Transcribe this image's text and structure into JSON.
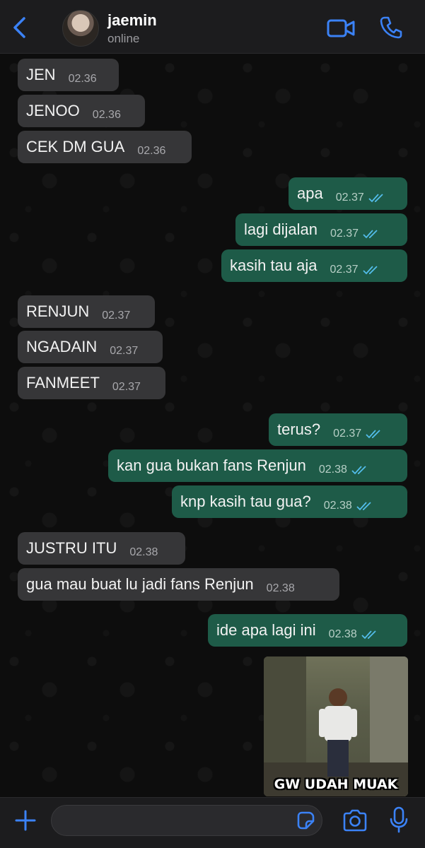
{
  "colors": {
    "accent": "#3b82f6",
    "incoming_bubble": "#363638",
    "outgoing_bubble": "#1e5b48",
    "read_ticks": "#53bdeb"
  },
  "header": {
    "contact_name": "jaemin",
    "status": "online",
    "icons": [
      "chevron-left-icon",
      "video-call-icon",
      "phone-icon"
    ]
  },
  "messages": [
    {
      "dir": "in",
      "text": "JEN",
      "time": "02.36"
    },
    {
      "dir": "in",
      "text": "JENOO",
      "time": "02.36"
    },
    {
      "dir": "in",
      "text": "CEK DM GUA",
      "time": "02.36"
    },
    {
      "dir": "out",
      "text": "apa",
      "time": "02.37",
      "read": true
    },
    {
      "dir": "out",
      "text": "lagi dijalan",
      "time": "02.37",
      "read": true
    },
    {
      "dir": "out",
      "text": "kasih tau aja",
      "time": "02.37",
      "read": true
    },
    {
      "dir": "in",
      "text": "RENJUN",
      "time": "02.37"
    },
    {
      "dir": "in",
      "text": "NGADAIN",
      "time": "02.37"
    },
    {
      "dir": "in",
      "text": "FANMEET",
      "time": "02.37"
    },
    {
      "dir": "out",
      "text": "terus?",
      "time": "02.37",
      "read": true
    },
    {
      "dir": "out",
      "text": "kan gua bukan fans Renjun",
      "time": "02.38",
      "read": true
    },
    {
      "dir": "out",
      "text": "knp kasih tau gua?",
      "time": "02.38",
      "read": true
    },
    {
      "dir": "in",
      "text": "JUSTRU ITU",
      "time": "02.38"
    },
    {
      "dir": "in",
      "text": "gua mau buat lu jadi fans Renjun",
      "time": "02.38"
    },
    {
      "dir": "out",
      "text": "ide apa lagi ini",
      "time": "02.38",
      "read": true
    }
  ],
  "image_message": {
    "caption": "GW UDAH MUAK"
  },
  "composer": {
    "value": "",
    "icons": [
      "plus-icon",
      "sticker-icon",
      "camera-icon",
      "microphone-icon"
    ]
  }
}
